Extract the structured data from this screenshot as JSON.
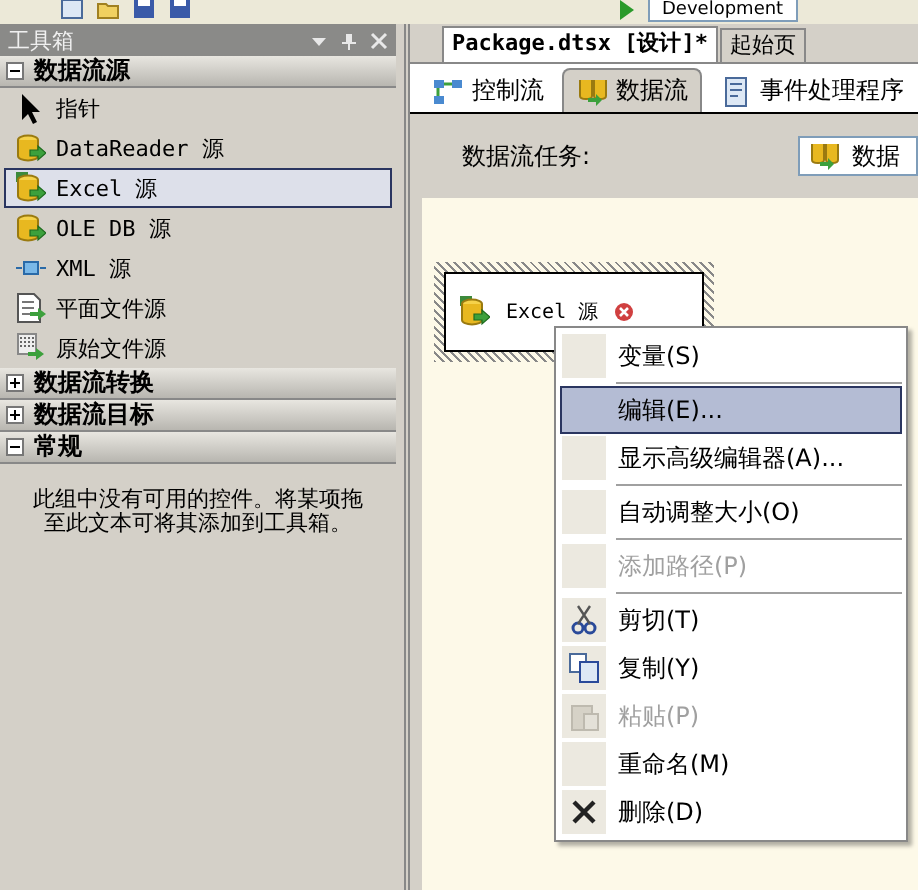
{
  "toolbar": {
    "configuration": "Development"
  },
  "toolbox": {
    "title": "工具箱",
    "groups": [
      {
        "label": "数据流源",
        "expanded": true,
        "items": [
          {
            "label": "指针",
            "kind": "pointer",
            "selected": false
          },
          {
            "label": "DataReader 源",
            "kind": "database",
            "selected": false
          },
          {
            "label": "Excel 源",
            "kind": "excel",
            "selected": true
          },
          {
            "label": "OLE DB 源",
            "kind": "database",
            "selected": false
          },
          {
            "label": "XML 源",
            "kind": "xml",
            "selected": false
          },
          {
            "label": "平面文件源",
            "kind": "file",
            "selected": false
          },
          {
            "label": "原始文件源",
            "kind": "raw",
            "selected": false
          }
        ]
      },
      {
        "label": "数据流转换",
        "expanded": false
      },
      {
        "label": "数据流目标",
        "expanded": false
      },
      {
        "label": "常规",
        "expanded": true,
        "empty_message": "此组中没有可用的控件。将某项拖至此文本可将其添加到工具箱。"
      }
    ]
  },
  "document_tabs": [
    {
      "label": "Package.dtsx [设计]*",
      "selected": true
    },
    {
      "label": "起始页",
      "selected": false
    }
  ],
  "designer_tabs": [
    {
      "label": "控制流",
      "kind": "control",
      "selected": false
    },
    {
      "label": "数据流",
      "kind": "dataflow",
      "selected": true
    },
    {
      "label": "事件处理程序",
      "kind": "event",
      "selected": false
    }
  ],
  "task_label": "数据流任务:",
  "task_combo": "数据",
  "node": {
    "label": "Excel 源",
    "error": true
  },
  "context_menu": [
    [
      {
        "label": "变量(S)",
        "kind": "plain",
        "disabled": false,
        "selected": false
      }
    ],
    [
      {
        "label": "编辑(E)...",
        "kind": "plain",
        "disabled": false,
        "selected": true
      },
      {
        "label": "显示高级编辑器(A)...",
        "kind": "plain",
        "disabled": false,
        "selected": false
      }
    ],
    [
      {
        "label": "自动调整大小(O)",
        "kind": "plain",
        "disabled": false,
        "selected": false
      }
    ],
    [
      {
        "label": "添加路径(P)",
        "kind": "plain",
        "disabled": true,
        "selected": false
      }
    ],
    [
      {
        "label": "剪切(T)",
        "kind": "cut",
        "disabled": false,
        "selected": false
      },
      {
        "label": "复制(Y)",
        "kind": "copy",
        "disabled": false,
        "selected": false
      },
      {
        "label": "粘贴(P)",
        "kind": "paste",
        "disabled": true,
        "selected": false
      },
      {
        "label": "重命名(M)",
        "kind": "plain",
        "disabled": false,
        "selected": false
      },
      {
        "label": "删除(D)",
        "kind": "delete",
        "disabled": false,
        "selected": false
      }
    ]
  ]
}
